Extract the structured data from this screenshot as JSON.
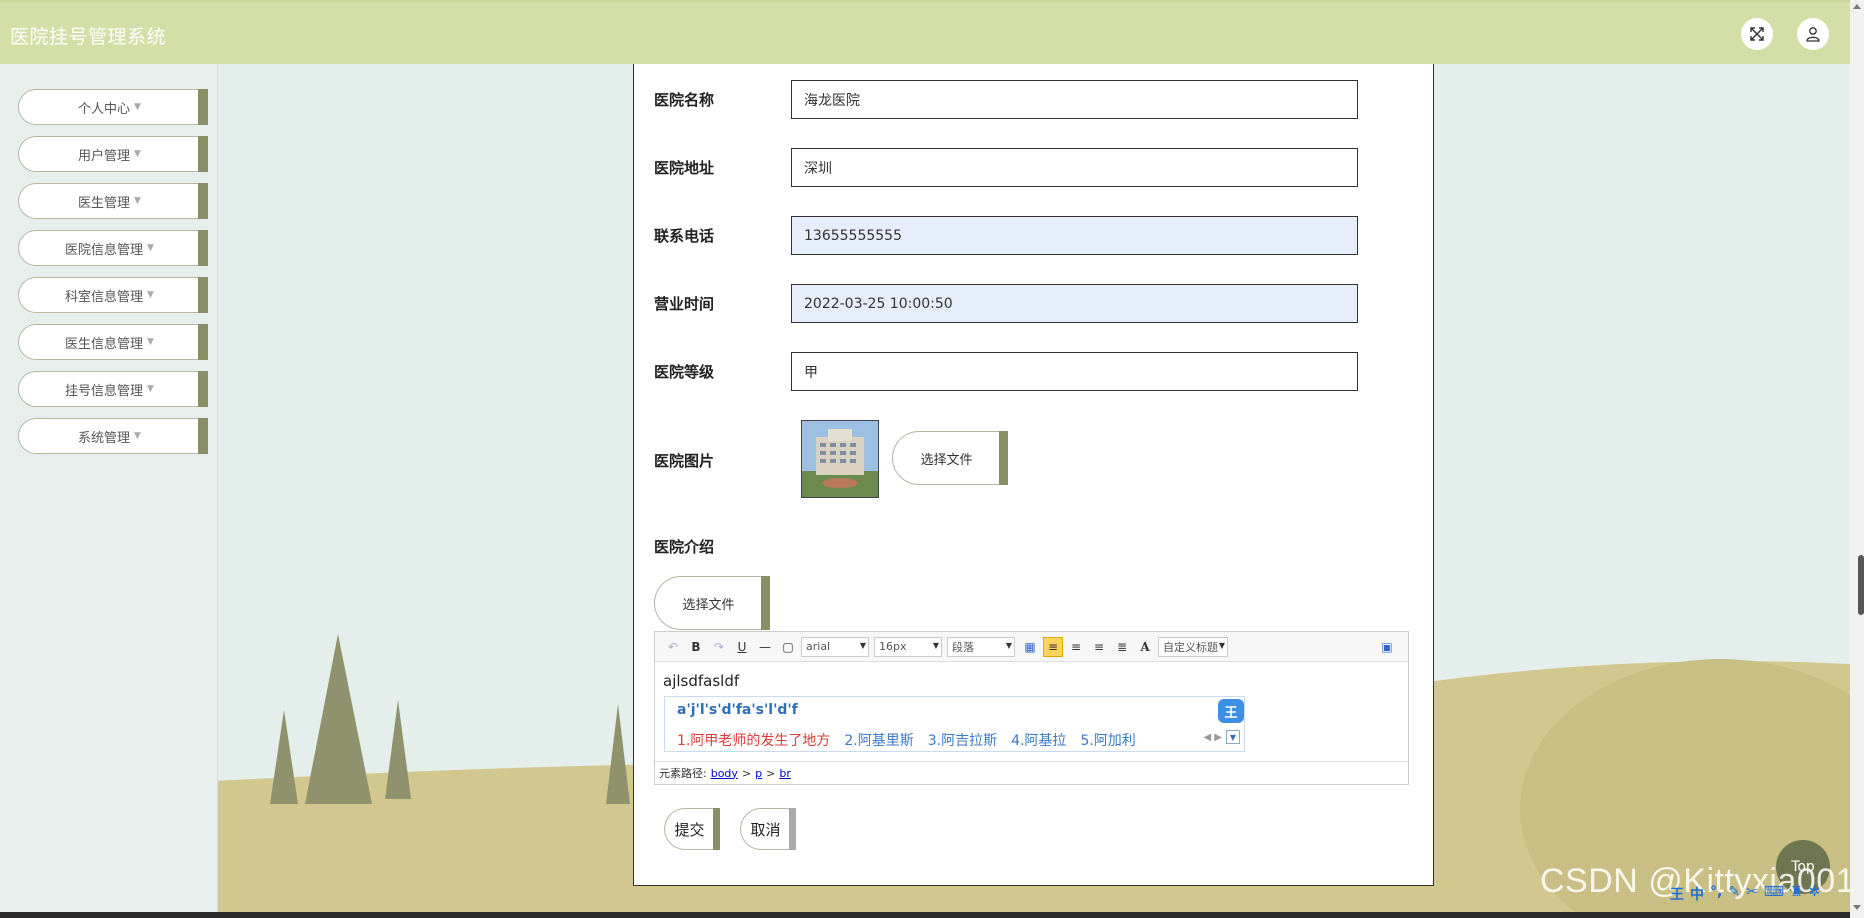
{
  "header": {
    "title": "医院挂号管理系统",
    "fullscreen_icon": "expand-icon",
    "user_icon": "user-icon"
  },
  "sidebar": {
    "items": [
      {
        "label": "个人中心"
      },
      {
        "label": "用户管理"
      },
      {
        "label": "医生管理"
      },
      {
        "label": "医院信息管理"
      },
      {
        "label": "科室信息管理"
      },
      {
        "label": "医生信息管理"
      },
      {
        "label": "挂号信息管理"
      },
      {
        "label": "系统管理"
      }
    ]
  },
  "form": {
    "hospital_name": {
      "label": "医院名称",
      "value": "海龙医院"
    },
    "hospital_address": {
      "label": "医院地址",
      "value": "深圳"
    },
    "phone": {
      "label": "联系电话",
      "value": "13655555555"
    },
    "business_hours": {
      "label": "营业时间",
      "value": "2022-03-25 10:00:50"
    },
    "level": {
      "label": "医院等级",
      "value": "甲"
    },
    "image": {
      "label": "医院图片",
      "choose_file": "选择文件"
    },
    "intro": {
      "label": "医院介绍",
      "choose_file": "选择文件"
    }
  },
  "editor": {
    "font_family": "arial",
    "font_size": "16px",
    "paragraph": "段落",
    "custom_title": "自定义标题",
    "content": "ajlsdfasldf",
    "element_path_label": "元素路径:",
    "path": [
      "body",
      "p",
      "br"
    ]
  },
  "ime": {
    "composition": "a'j'l's'd'fa's'l'd'f",
    "logo": "王",
    "candidates": [
      "1.阿甲老师的发生了地方",
      "2.阿基里斯",
      "3.阿吉拉斯",
      "4.阿基拉",
      "5.阿加利"
    ]
  },
  "actions": {
    "submit": "提交",
    "cancel": "取消"
  },
  "top_button": "Top",
  "watermark": "CSDN @Kittyxia001",
  "colors": {
    "header_bg": "#d4dfa8",
    "accent": "#8b8f66",
    "page_bg": "#e6efec",
    "filled_input": "#e6eefb"
  }
}
